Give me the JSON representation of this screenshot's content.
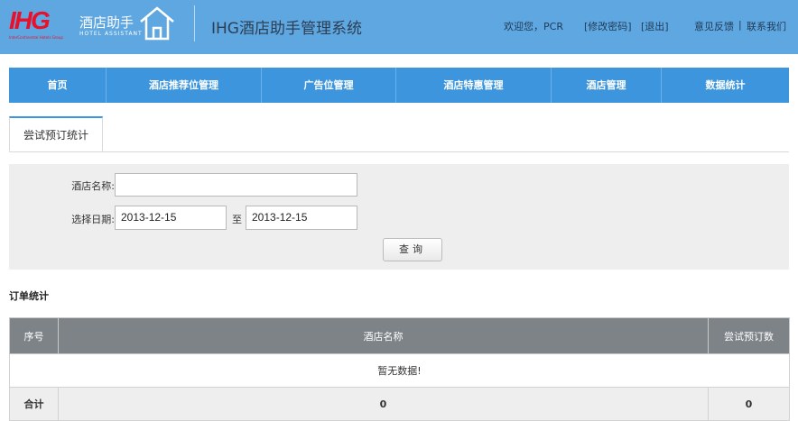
{
  "header": {
    "logo_letters": "IHG",
    "logo_group_text": "InterContinental Hotels Group",
    "logo_cn": "酒店助手",
    "logo_en": "HOTEL ASSISTANT",
    "system_title": "IHG酒店助手管理系统",
    "welcome": "欢迎您，PCR",
    "change_password": "[修改密码]",
    "logout": "[退出]",
    "feedback": "意见反馈",
    "separator": "|",
    "contact": "联系我们"
  },
  "nav": {
    "items": [
      "首页",
      "酒店推荐位管理",
      "广告位管理",
      "酒店特惠管理",
      "酒店管理",
      "数据统计"
    ]
  },
  "tabs": {
    "active": "尝试预订统计"
  },
  "search": {
    "hotel_name_label": "酒店名称:",
    "hotel_name_value": "",
    "date_label": "选择日期:",
    "date_from": "2013-12-15",
    "to_label": "至",
    "date_to": "2013-12-15",
    "query_button": "查询"
  },
  "orders": {
    "section_title": "订单统计",
    "columns": [
      "序号",
      "酒店名称",
      "尝试预订数"
    ],
    "empty_message": "暂无数据!",
    "total_label": "合计",
    "total_hotel": "0",
    "total_count": "0"
  },
  "colors": {
    "header_bg": "#5fa7e0",
    "nav_bg": "#3d96dd",
    "table_header_bg": "#7e8388",
    "logo_red": "#e8102a"
  }
}
